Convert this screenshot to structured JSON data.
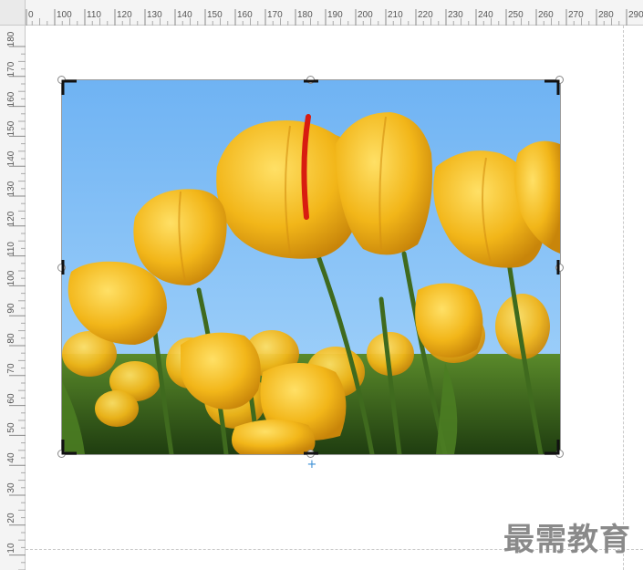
{
  "ruler": {
    "horizontal_labels": [
      "0",
      "100",
      "110",
      "120",
      "130",
      "140",
      "150",
      "160",
      "170",
      "180",
      "190",
      "200",
      "210",
      "220",
      "230",
      "240",
      "250",
      "260",
      "270",
      "280",
      "290"
    ],
    "vertical_labels": [
      "180",
      "170",
      "160",
      "150",
      "140",
      "130",
      "120",
      "110",
      "100",
      "90",
      "80",
      "70",
      "60",
      "50",
      "40",
      "30",
      "20",
      "10"
    ]
  },
  "image": {
    "subject": "yellow tulips against blue sky",
    "sky_color": "#7cbef5",
    "petal_color": "#f2b619",
    "stem_color": "#3f6a1e"
  },
  "selection": {
    "handle_color": "#888888",
    "crop_mark_color": "#111111",
    "rotate_icon": "plus-icon"
  },
  "watermark": {
    "text": "最需教育"
  }
}
